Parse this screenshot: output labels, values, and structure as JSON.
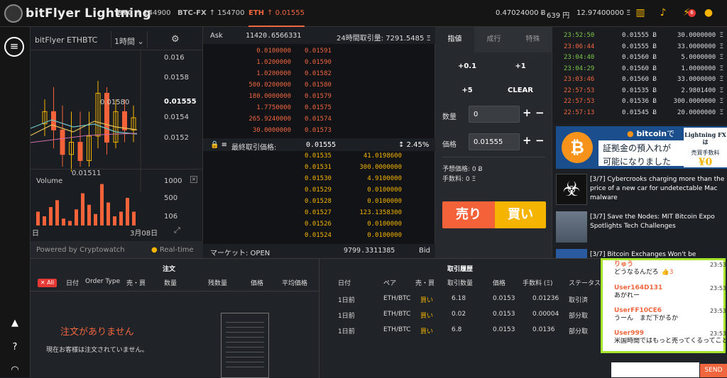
{
  "header": {
    "logo_text": "bitFlyer Lightning",
    "tickers": [
      {
        "symbol": "BTC",
        "value": "144900"
      },
      {
        "symbol": "BTC-FX",
        "value": "154700"
      },
      {
        "symbol": "ETH",
        "value": "0.01555"
      }
    ],
    "balances": [
      "0.47024000 Ƀ",
      "639 円",
      "12.97400000 Ξ"
    ],
    "notification_count": "6"
  },
  "chart": {
    "pair_label": "bitFlyer ETHBTC",
    "interval": "1時間",
    "price_ticks": [
      "0.016",
      "0.0158",
      "0.01555",
      "0.0154",
      "0.0152"
    ],
    "high_label": "0.01580",
    "low_label": "0.01511",
    "volume_label": "Volume",
    "volume_ticks": [
      "1000",
      "500",
      "106"
    ],
    "x_labels": [
      "日",
      "3月08日"
    ],
    "powered_by": "Powered by Cryptowatch",
    "realtime": "Real-time",
    "candles": [
      {
        "o": 0.0155,
        "c": 0.0156,
        "h": 0.0157,
        "l": 0.0154
      },
      {
        "o": 0.0156,
        "c": 0.01545,
        "h": 0.0158,
        "l": 0.0153
      },
      {
        "o": 0.01545,
        "c": 0.01525,
        "h": 0.01565,
        "l": 0.01515
      },
      {
        "o": 0.01525,
        "c": 0.01535,
        "h": 0.0156,
        "l": 0.01511
      },
      {
        "o": 0.01535,
        "c": 0.0152,
        "h": 0.0156,
        "l": 0.01515
      },
      {
        "o": 0.0152,
        "c": 0.0154,
        "h": 0.0156,
        "l": 0.01515
      },
      {
        "o": 0.0154,
        "c": 0.01575,
        "h": 0.01585,
        "l": 0.0153
      },
      {
        "o": 0.01575,
        "c": 0.01535,
        "h": 0.0158,
        "l": 0.01525
      },
      {
        "o": 0.01535,
        "c": 0.0156,
        "h": 0.0157,
        "l": 0.0153
      },
      {
        "o": 0.0156,
        "c": 0.01545,
        "h": 0.0157,
        "l": 0.01535
      },
      {
        "o": 0.01545,
        "c": 0.01555,
        "h": 0.01565,
        "l": 0.01535
      }
    ],
    "volumes": [
      300,
      200,
      400,
      550,
      150,
      100,
      350,
      700,
      450,
      250,
      900,
      500,
      200,
      300,
      600,
      300
    ]
  },
  "orderbook": {
    "ask_label": "Ask",
    "ask_total": "11420.6566331",
    "volume_label": "24時間取引量: 7291.5485 Ξ",
    "asks": [
      [
        "0.0100000",
        "0.01591"
      ],
      [
        "1.0200000",
        "0.01590"
      ],
      [
        "1.0200000",
        "0.01582"
      ],
      [
        "500.0200000",
        "0.01580"
      ],
      [
        "180.0000000",
        "0.01579"
      ],
      [
        "1.7750000",
        "0.01575"
      ],
      [
        "265.9240000",
        "0.01574"
      ],
      [
        "30.0000000",
        "0.01573"
      ]
    ],
    "last_price_label": "最終取引価格:",
    "last_price": "0.01555",
    "change": "2.45%",
    "bids": [
      [
        "0.01535",
        "41.0198600"
      ],
      [
        "0.01531",
        "300.0000000"
      ],
      [
        "0.01530",
        "4.9100000"
      ],
      [
        "0.01529",
        "0.0100000"
      ],
      [
        "0.01528",
        "0.0100000"
      ],
      [
        "0.01527",
        "123.1358300"
      ],
      [
        "0.01526",
        "0.0100000"
      ],
      [
        "0.01524",
        "0.0100000"
      ]
    ],
    "market_label": "マーケット: OPEN",
    "bid_total": "9799.3311385",
    "bid_label": "Bid"
  },
  "trade": {
    "tabs": [
      "指値",
      "成行",
      "特殊"
    ],
    "quick": [
      "+0.1",
      "+1",
      "+5",
      "CLEAR"
    ],
    "qty_label": "数量",
    "qty_value": "0",
    "price_label": "価格",
    "price_value": "0.01555",
    "est_label": "予想価格: 0 Ƀ",
    "fee_label": "手数料: 0 Ξ",
    "sell": "売り",
    "buy": "買い"
  },
  "executions": [
    [
      "23:52:50",
      "0.01555 Ƀ",
      "30.0000000 Ξ",
      "green"
    ],
    [
      "23:06:44",
      "0.01555 Ƀ",
      "33.0000000 Ξ",
      "red"
    ],
    [
      "23:04:40",
      "0.01560 Ƀ",
      "5.0000000 Ξ",
      "green"
    ],
    [
      "23:04:29",
      "0.01560 Ƀ",
      "1.0000000 Ξ",
      "green"
    ],
    [
      "23:03:46",
      "0.01560 Ƀ",
      "33.0000000 Ξ",
      "red"
    ],
    [
      "22:57:53",
      "0.01535 Ƀ",
      "2.9801400 Ξ",
      "red"
    ],
    [
      "22:57:53",
      "0.01536 Ƀ",
      "300.0000000 Ξ",
      "red"
    ],
    [
      "22:57:13",
      "0.01545 Ƀ",
      "20.0000000 Ξ",
      "red"
    ]
  ],
  "ad": {
    "brand": "bitcoin",
    "tail": "で",
    "line1": "証拠金の預入れが",
    "line2": "可能になりました",
    "side1": "Lightning FXは",
    "side2": "売買手数料",
    "side3": "¥0"
  },
  "news": [
    {
      "text": "[3/7] Cybercrooks charging more than the price of a new car for undetectable Mac malware"
    },
    {
      "text": "[3/7] Save the Nodes: MIT Bitcoin Expo Spotlights Tech Challenges"
    },
    {
      "text": "[3/7] Bitcoin Exchanges Won't be Prohibited"
    }
  ],
  "orders": {
    "title": "注文",
    "all_badge": "All",
    "columns": [
      "日付",
      "Order Type",
      "売・買",
      "数量",
      "残数量",
      "価格",
      "平均価格"
    ],
    "empty_title": "注文がありません",
    "empty_text": "現在お客様は注文されていません。"
  },
  "history": {
    "title": "取引履歴",
    "columns": [
      "日付",
      "ペア",
      "売・買",
      "取引数量",
      "価格",
      "手数料 (Ξ)",
      "ステータス"
    ],
    "rows": [
      [
        "1日前",
        "ETH/BTC",
        "買い",
        "6.18",
        "0.0153",
        "0.01236",
        "取引済"
      ],
      [
        "1日前",
        "ETH/BTC",
        "買い",
        "0.02",
        "0.0153",
        "0.00004",
        "部分取"
      ],
      [
        "1日前",
        "ETH/BTC",
        "買い",
        "6.8",
        "0.0153",
        "0.0136",
        "部分取"
      ]
    ]
  },
  "chat": {
    "messages": [
      {
        "name": "りゅう",
        "time": "23:53",
        "text": "どうなるんだろ",
        "likes": "3"
      },
      {
        "name": "User164D131",
        "time": "23:53",
        "text": "あがれー",
        "likes": ""
      },
      {
        "name": "UserFF10CE6",
        "time": "23:53",
        "text": "うーん　まだ下がるか",
        "likes": ""
      },
      {
        "name": "User999",
        "time": "23:53",
        "text": "米国時間ではもっと売ってくるってことですか",
        "likes": ""
      }
    ],
    "send": "SEND"
  },
  "colors": {
    "accent": "#f0663f",
    "buy": "#f5b400",
    "sell": "#f4623a",
    "chat_border": "#a5e62c"
  }
}
